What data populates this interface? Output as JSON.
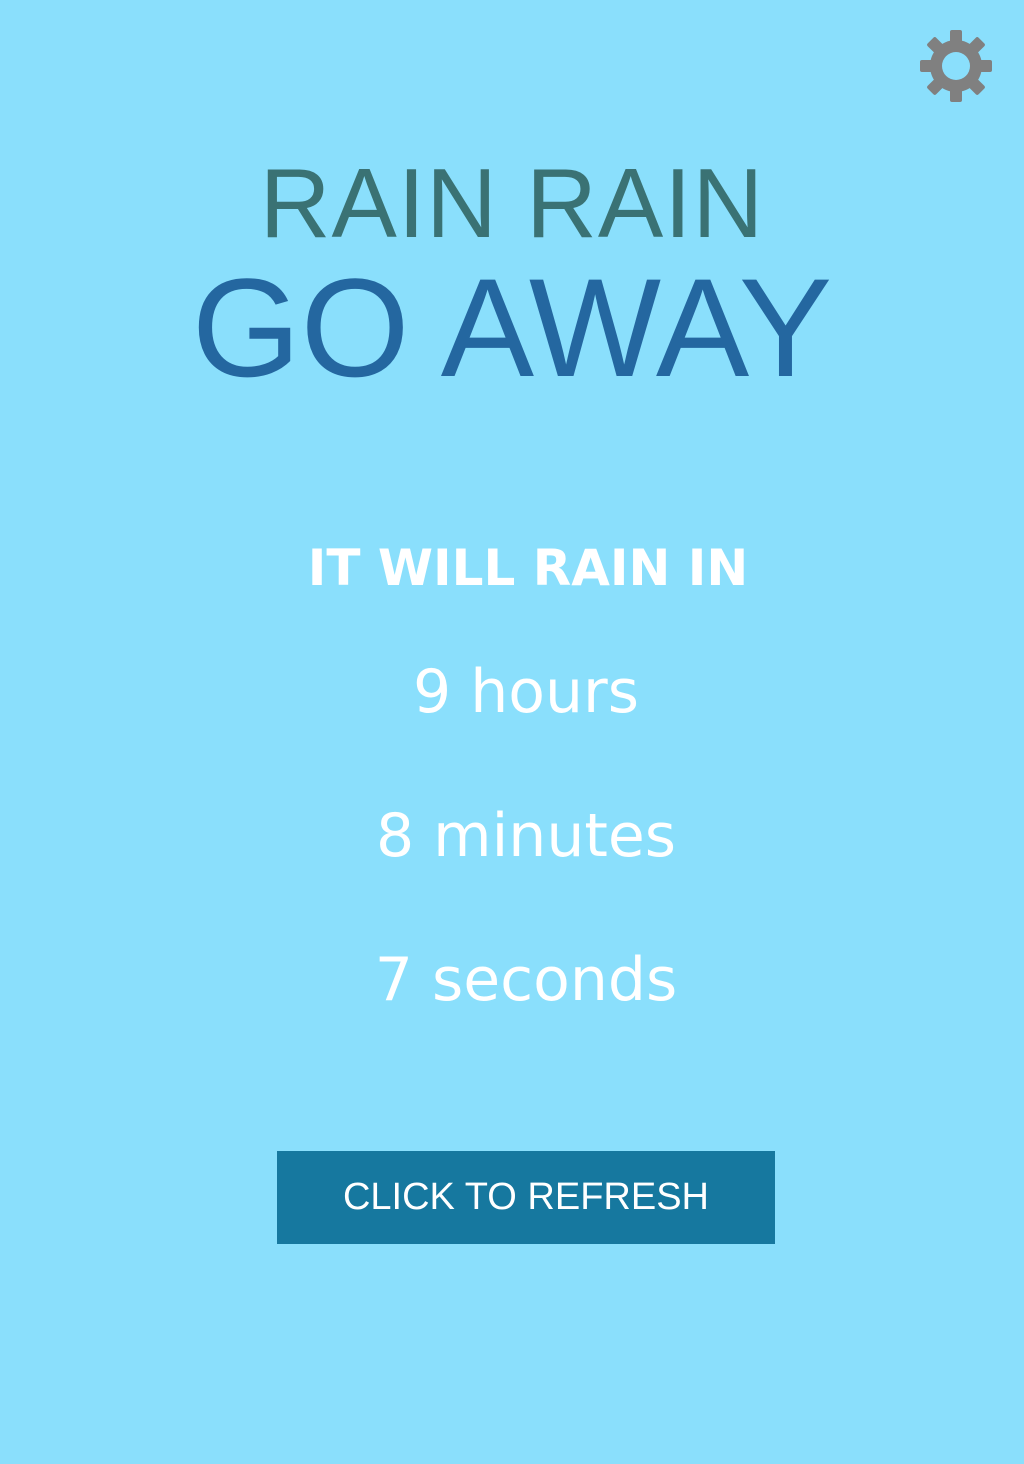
{
  "settings": {
    "icon": "gear-icon",
    "color": "#808080"
  },
  "title": {
    "line1": "RAIN RAIN",
    "line2": "GO AWAY",
    "line1_color": "#3a7274",
    "line2_color": "#2467a0"
  },
  "forecast": {
    "heading": "IT WILL RAIN IN",
    "hours": "9 hours",
    "minutes": "8 minutes",
    "seconds": "7 seconds"
  },
  "refresh": {
    "label": "CLICK TO REFRESH",
    "color": "#16789f"
  },
  "colors": {
    "background": "#8adffc",
    "text": "#ffffff"
  }
}
